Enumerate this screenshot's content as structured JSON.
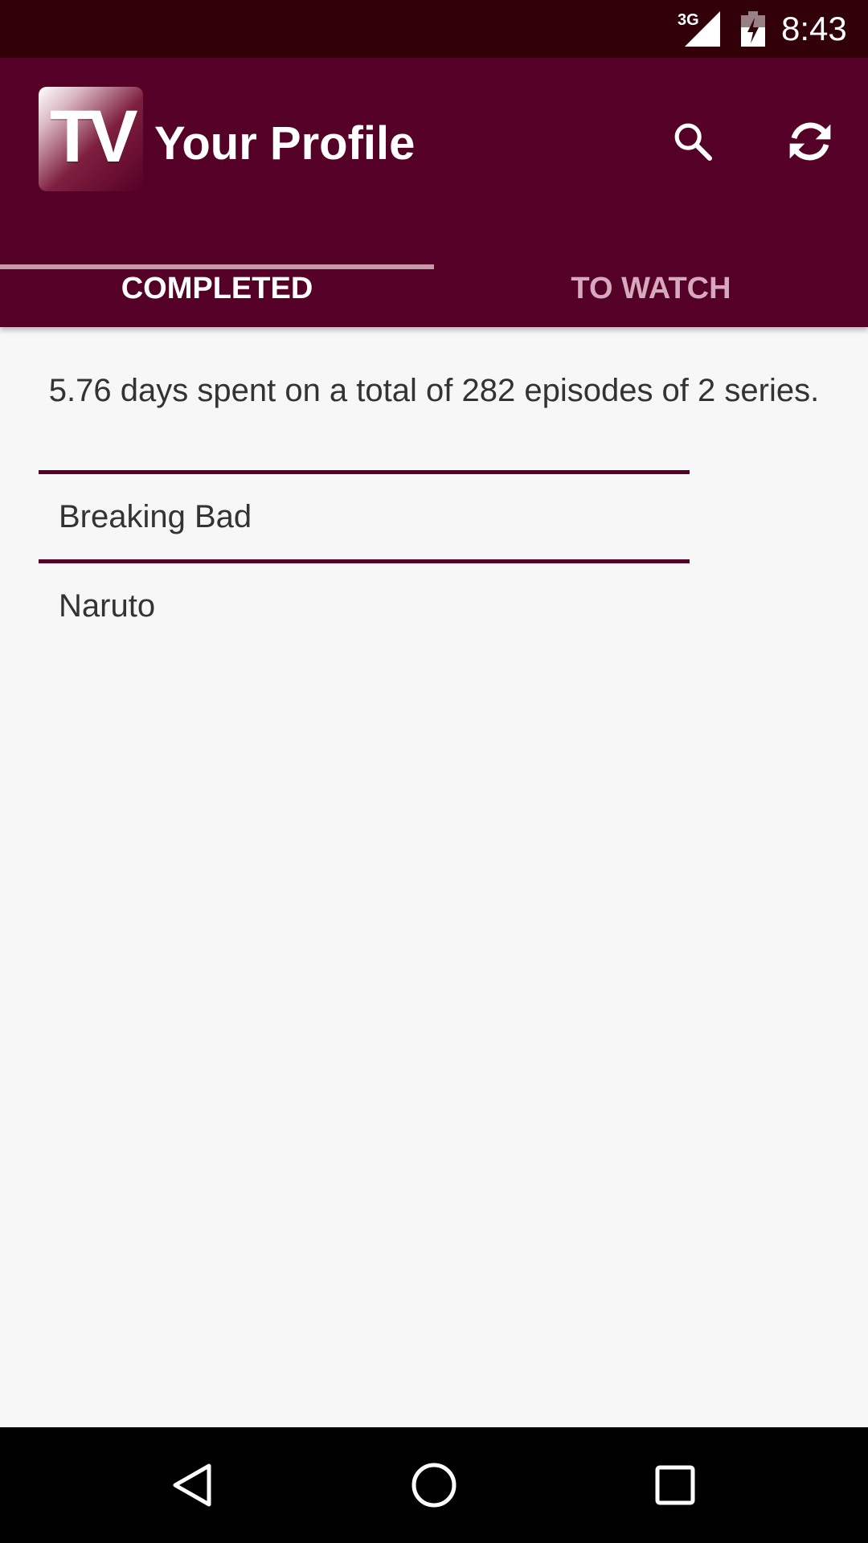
{
  "status_bar": {
    "network": "3G",
    "time": "8:43"
  },
  "app_bar": {
    "logo_text": "TV",
    "title": "Your Profile",
    "actions": [
      {
        "icon": "search-icon"
      },
      {
        "icon": "refresh-icon"
      }
    ]
  },
  "tabs": [
    {
      "label": "COMPLETED",
      "selected": true
    },
    {
      "label": "TO WATCH",
      "selected": false
    }
  ],
  "summary": "5.76 days spent on a total of 282 episodes of 2 series.",
  "series": [
    {
      "title": "Breaking Bad"
    },
    {
      "title": "Naruto"
    }
  ],
  "colors": {
    "primary": "#550026",
    "status_bar": "#310009",
    "background": "#f7f7f7",
    "tab_inactive": "#d7a9bc",
    "tab_indicator": "#c49aa9"
  },
  "nav_bar": {
    "buttons": [
      {
        "icon": "back-icon"
      },
      {
        "icon": "home-icon"
      },
      {
        "icon": "recents-icon"
      }
    ]
  }
}
